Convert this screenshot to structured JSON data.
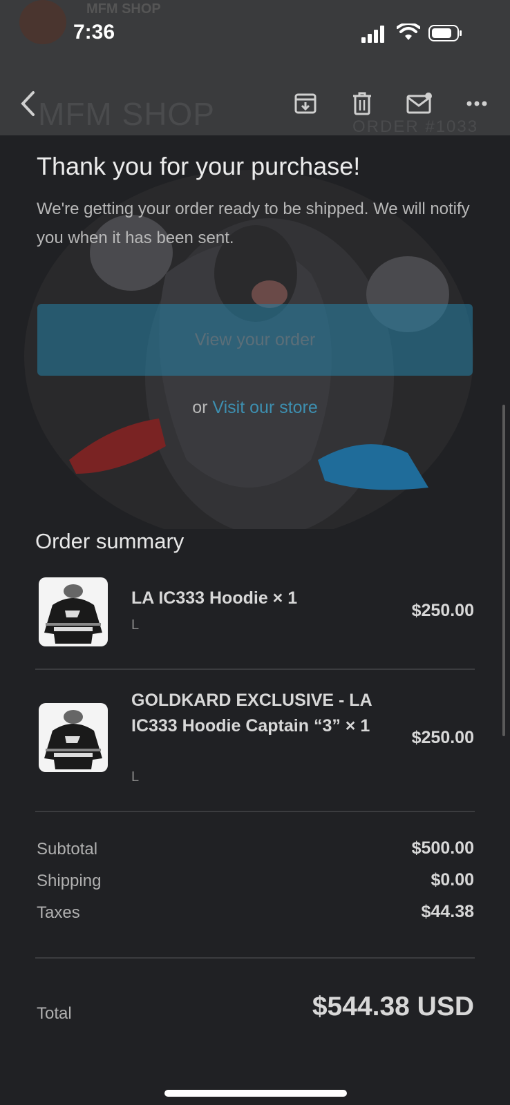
{
  "status_bar": {
    "time": "7:36",
    "ghost_sender": "MFM SHOP"
  },
  "toolbar": {
    "ghost_logo": "MFM SHOP",
    "ghost_order": "ORDER #1033"
  },
  "email": {
    "title": "Thank you for your purchase!",
    "subtitle": "We're getting your order ready to be shipped. We will notify you when it has been sent.",
    "view_order_button": "View your order",
    "visit_prefix": "or",
    "visit_link": "Visit our store",
    "accent_color": "#3d8fb0"
  },
  "order_summary": {
    "title": "Order summary",
    "items": [
      {
        "name": "LA IC333 Hoodie × 1",
        "variant": "L",
        "price": "$250.00"
      },
      {
        "name": "GOLDKARD EXCLUSIVE - LA IC333 Hoodie Captain “3” × 1",
        "variant": "L",
        "price": "$250.00"
      }
    ]
  },
  "totals": {
    "subtotal_label": "Subtotal",
    "subtotal": "$500.00",
    "shipping_label": "Shipping",
    "shipping": "$0.00",
    "taxes_label": "Taxes",
    "taxes": "$44.38",
    "total_label": "Total",
    "total": "$544.38 USD"
  },
  "icons": [
    "back-icon",
    "archive-icon",
    "trash-icon",
    "mail-unread-icon",
    "more-icon",
    "signal-icon",
    "wifi-icon",
    "battery-icon"
  ]
}
